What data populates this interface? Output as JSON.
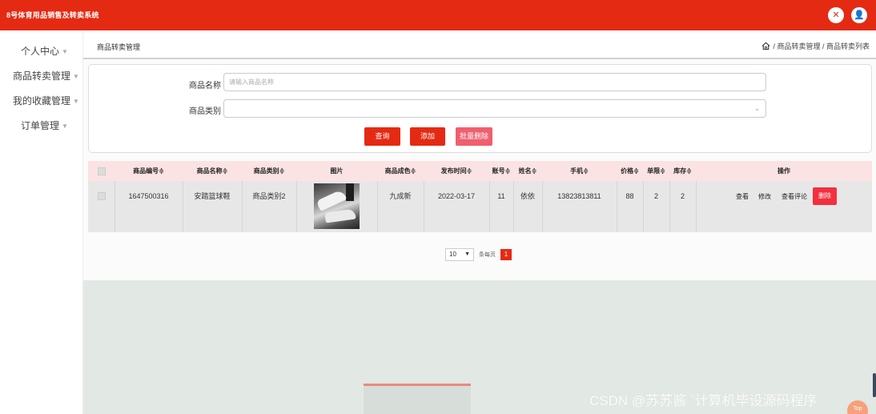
{
  "app": {
    "title": "8号体育用品销售及转卖系统"
  },
  "header_icons": [
    "close-circle-icon",
    "user-icon"
  ],
  "sidebar": {
    "items": [
      {
        "label": "个人中心"
      },
      {
        "label": "商品转卖管理"
      },
      {
        "label": "我的收藏管理"
      },
      {
        "label": "订单管理"
      }
    ]
  },
  "page": {
    "title": "商品转卖管理",
    "breadcrumb": "/ 商品转卖管理 / 商品转卖列表"
  },
  "search": {
    "name_label": "商品名称",
    "name_placeholder": "请输入商品名称",
    "category_label": "商品类别",
    "category_value": "",
    "query_label": "查询",
    "add_label": "添加",
    "batch_delete_label": "批量删除"
  },
  "table": {
    "headers": {
      "id": "商品编号≑",
      "name": "商品名称≑",
      "category": "商品类别≑",
      "image": "图片",
      "condition": "商品成色≑",
      "publish_time": "发布时间≑",
      "account": "账号≑",
      "person_name": "姓名≑",
      "phone": "手机≑",
      "price": "价格≑",
      "limit": "单限≑",
      "stock": "库存≑",
      "actions": "操作"
    },
    "rows": [
      {
        "id": "1647500316",
        "name": "安踏篮球鞋",
        "category": "商品类别2",
        "condition": "九成新",
        "publish_time": "2022-03-17",
        "account": "11",
        "person_name": "依依",
        "phone": "13823813811",
        "price": "88",
        "limit": "2",
        "stock": "2",
        "actions": {
          "view": "查看",
          "edit": "修改",
          "comments": "查看评论",
          "delete": "删除"
        }
      }
    ]
  },
  "pagination": {
    "page_size": "10",
    "per_page_label": "条每页",
    "current_page": "1"
  },
  "watermark": "CSDN @苏苏酱    `计算机毕设源码程序",
  "back_to_top": "Top",
  "colors": {
    "brand": "#e52a13",
    "header_row": "#fbe3e3",
    "delete_button": "#f2303f"
  }
}
